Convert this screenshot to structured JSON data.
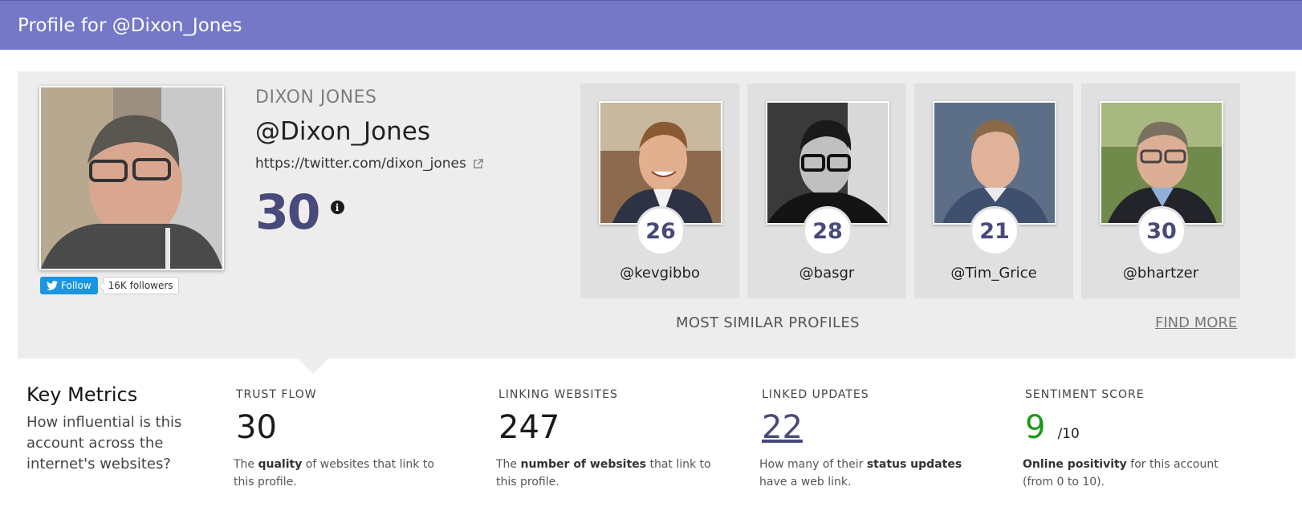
{
  "header": {
    "title": "Profile for @Dixon_Jones"
  },
  "profile": {
    "real_name": "DIXON JONES",
    "handle": "@Dixon_Jones",
    "url": "https://twitter.com/dixon_jones",
    "score": "30",
    "follow_label": "Follow",
    "followers": "16K followers"
  },
  "similar": {
    "title": "MOST SIMILAR PROFILES",
    "find_more": "FIND MORE",
    "profiles": [
      {
        "score": "26",
        "handle": "@kevgibbo"
      },
      {
        "score": "28",
        "handle": "@basgr"
      },
      {
        "score": "21",
        "handle": "@Tim_Grice"
      },
      {
        "score": "30",
        "handle": "@bhartzer"
      }
    ]
  },
  "metrics": {
    "title": "Key Metrics",
    "description": "How influential is this account across the internet's websites?",
    "trust_flow": {
      "label": "TRUST FLOW",
      "value": "30",
      "desc_pre": "The ",
      "desc_bold": "quality",
      "desc_post": " of websites that link to this profile."
    },
    "linking_websites": {
      "label": "LINKING WEBSITES",
      "value": "247",
      "desc_pre": "The ",
      "desc_bold": "number of websites",
      "desc_post": " that link to this profile."
    },
    "linked_updates": {
      "label": "LINKED UPDATES",
      "value": "22",
      "desc_pre": "How many of their ",
      "desc_bold": "status updates",
      "desc_post": " have a web link."
    },
    "sentiment": {
      "label": "SENTIMENT SCORE",
      "value": "9",
      "out_of": "/10",
      "desc_pre": "",
      "desc_bold": "Online positivity",
      "desc_post": " for this account (from 0 to 10)."
    }
  },
  "colors": {
    "header_bg": "#7478c6",
    "score_color": "#474a7a",
    "twitter_blue": "#1b95e0",
    "sentiment_green": "#1a9a1a"
  },
  "icons": [
    "twitter-bird-icon",
    "external-link-icon",
    "info-icon"
  ]
}
